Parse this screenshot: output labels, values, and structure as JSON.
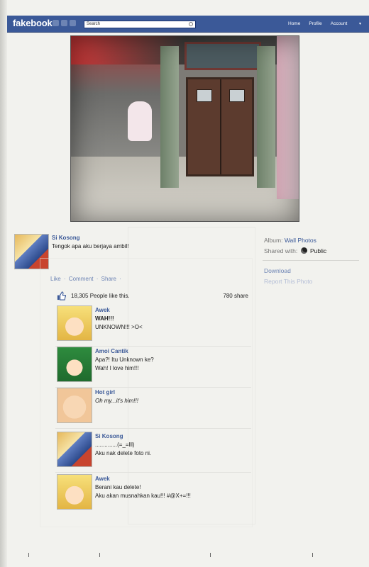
{
  "topbar": {
    "logo": "fakebook",
    "search_placeholder": "Search",
    "nav": [
      "Home",
      "Profile",
      "Account"
    ],
    "caret": "▾"
  },
  "photo": {
    "subject": "school corridor with girl at doorway"
  },
  "post": {
    "author": "Si Kosong",
    "text": "Tengok apa aku berjaya ambil!",
    "actions": [
      "Like",
      "Comment",
      "Share"
    ],
    "separator": "·"
  },
  "sidebar": {
    "album_label": "Album:",
    "album_value": "Wall Photos",
    "shared_label": "Shared with:",
    "shared_value": "Public",
    "download": "Download",
    "report": "Report This Photo"
  },
  "likes": {
    "text": "18,305 People like this.",
    "shares": "780 share"
  },
  "comments": [
    {
      "name": "Awek",
      "avatar": "awek",
      "lines": [
        "WAH!!!",
        "UNKNOWN!!! >O<"
      ]
    },
    {
      "name": "Amoi Cantik",
      "avatar": "amoi",
      "lines": [
        "Apa?! Itu Unknown ke?",
        "Wah! I love him!!!"
      ]
    },
    {
      "name": "Hot girl",
      "avatar": "hot",
      "lines": [
        "Oh my...it's him!!!"
      ]
    },
    {
      "name": "Si Kosong",
      "avatar": "sikosong",
      "lines": [
        "..............(=_=lll)",
        "Aku nak delete foto ni."
      ]
    },
    {
      "name": "Awek",
      "avatar": "awek",
      "lines": [
        "Berani kau delete!",
        "Aku akan musnahkan kau!!! #@X+=!!!"
      ]
    }
  ],
  "colors": {
    "brand": "#3b5998",
    "link": "#6d84b4"
  }
}
